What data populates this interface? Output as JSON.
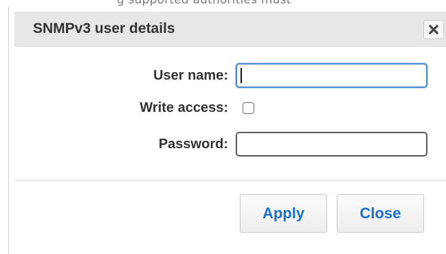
{
  "background": {
    "partial_text": "g       supported authorities must"
  },
  "dialog": {
    "title": "SNMPv3 user details",
    "close_icon": "close-x-icon"
  },
  "form": {
    "user_name_label": "User name:",
    "user_name_value": "",
    "write_access_label": "Write access:",
    "write_access_checked": false,
    "password_label": "Password:",
    "password_value": ""
  },
  "buttons": {
    "apply_label": "Apply",
    "close_label": "Close"
  },
  "colors": {
    "accent": "#1a6fd6",
    "titlebar": "#e7e7e7",
    "focus_border": "#4a8ad8"
  }
}
